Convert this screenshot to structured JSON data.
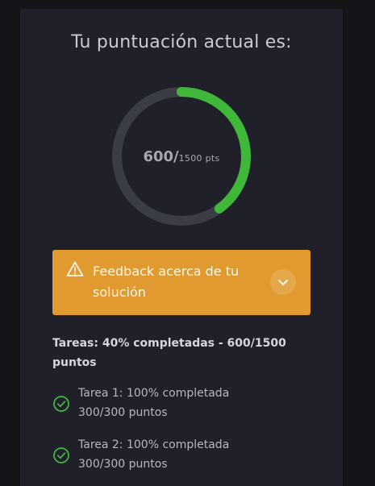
{
  "score": {
    "title": "Tu puntuación actual es:",
    "value": "600/",
    "total": "1500 pts",
    "progress_fraction": 0.4,
    "track_color": "#3b3d44",
    "fill_color": "#3fb83a"
  },
  "feedback": {
    "label": "Feedback acerca de tu solución",
    "icon": "warning-triangle",
    "toggle_icon": "chevron-down",
    "background": "#e09a30"
  },
  "tasks": {
    "summary": "Tareas: 40% completadas - 600/1500 puntos",
    "items": [
      {
        "title": "Tarea 1: 100% completada",
        "points": "300/300 puntos",
        "icon": "check-circle"
      },
      {
        "title": "Tarea 2: 100% completada",
        "points": "300/300 puntos",
        "icon": "check-circle"
      }
    ],
    "check_color": "#3fb83a"
  }
}
